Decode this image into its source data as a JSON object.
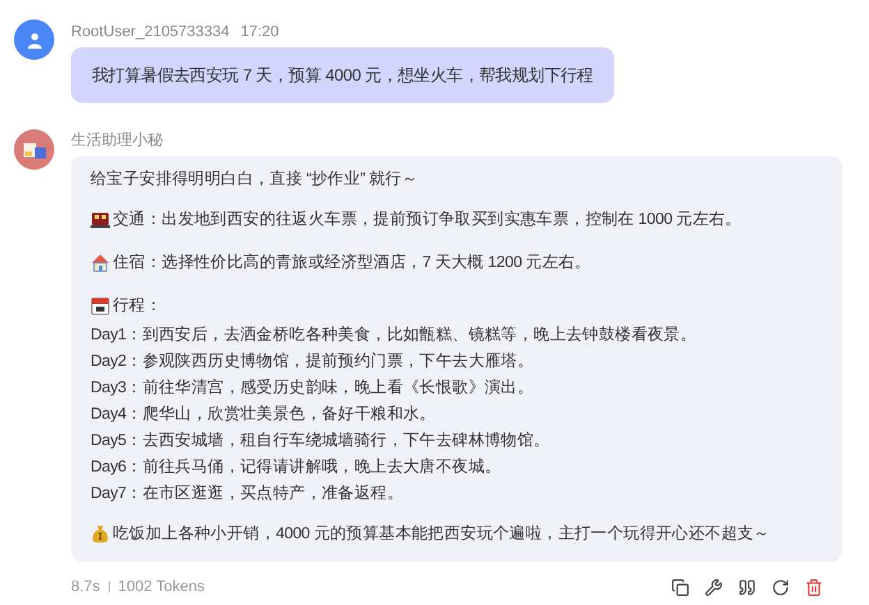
{
  "user": {
    "name": "RootUser_2105733334",
    "time": "17:20",
    "message": "我打算暑假去西安玩 7 天，预算 4000 元，想坐火车，帮我规划下行程"
  },
  "assistant": {
    "name": "生活助理小秘",
    "blocks": [
      {
        "kind": "text",
        "text": "给宝子安排得明明白白，直接 “抄作业” 就行～"
      },
      {
        "kind": "item",
        "text": "交通：出发地到西安的往返火车票，提前预订争取买到实惠车票，控制在 1000 元左右。"
      },
      {
        "kind": "item",
        "text": "住宿：选择性价比高的青旅或经济型酒店，7 天大概 1200 元左右。"
      },
      {
        "kind": "list",
        "heading": "行程：",
        "lines": [
          "Day1：到西安后，去洒金桥吃各种美食，比如甑糕、镜糕等，晚上去钟鼓楼看夜景。",
          "Day2：参观陕西历史博物馆，提前预约门票，下午去大雁塔。",
          "Day3：前往华清宫，感受历史韵味，晚上看《长恨歌》演出。",
          "Day4：爬华山，欣赏壮美景色，备好干粮和水。",
          "Day5：去西安城墙，租自行车绕城墙骑行，下午去碑林博物馆。",
          "Day6：前往兵马俑，记得请讲解哦，晚上去大唐不夜城。",
          "Day7：在市区逛逛，买点特产，准备返程。"
        ]
      },
      {
        "kind": "item",
        "text": "吃饭加上各种小开销，4000 元的预算基本能把西安玩个遍啦，主打一个玩得开心还不超支～"
      }
    ]
  },
  "footer": {
    "duration": "8.7s",
    "tokens": "1002 Tokens"
  }
}
